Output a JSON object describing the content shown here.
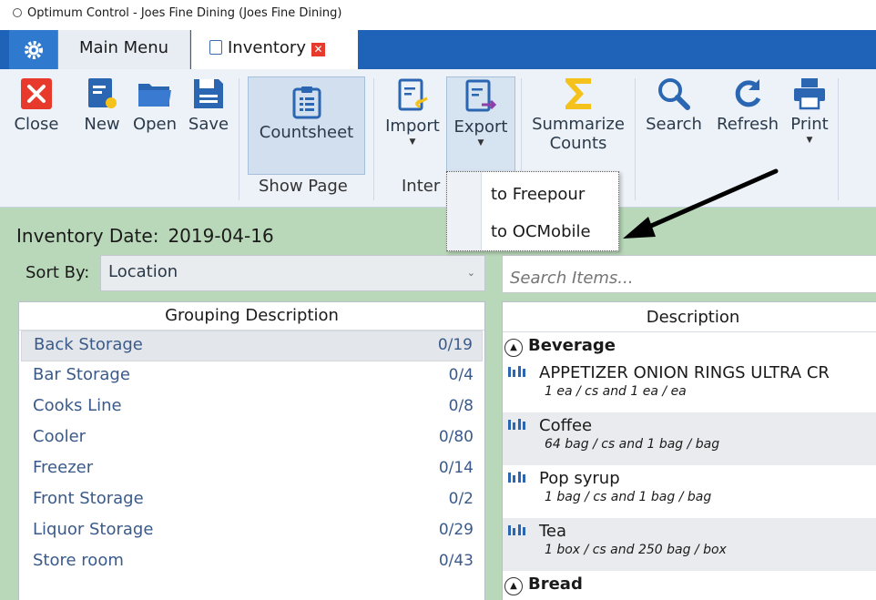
{
  "window": {
    "title": "Optimum Control -  Joes Fine Dining (Joes Fine Dining)"
  },
  "tabs": {
    "main_menu": "Main Menu",
    "inventory": "Inventory"
  },
  "ribbon": {
    "close": "Close",
    "new": "New",
    "open": "Open",
    "save": "Save",
    "countsheet": "Countsheet",
    "import": "Import",
    "export": "Export",
    "summarize_line1": "Summarize",
    "summarize_line2": "Counts",
    "search": "Search",
    "refresh": "Refresh",
    "print": "Print",
    "group_show_page": "Show Page",
    "group_inter": "Inter"
  },
  "export_menu": {
    "items": [
      "to Freepour",
      "to OCMobile"
    ]
  },
  "inventory": {
    "date_label": "Inventory Date:",
    "date_value": "2019-04-16",
    "sort_label": "Sort By:",
    "sort_value": "Location",
    "search_placeholder": "Search Items..."
  },
  "groups": {
    "header": "Grouping Description",
    "rows": [
      {
        "name": "Back Storage",
        "count": "0/19"
      },
      {
        "name": "Bar Storage",
        "count": "0/4"
      },
      {
        "name": "Cooks Line",
        "count": "0/8"
      },
      {
        "name": "Cooler",
        "count": "0/80"
      },
      {
        "name": "Freezer",
        "count": "0/14"
      },
      {
        "name": "Front Storage",
        "count": "0/2"
      },
      {
        "name": "Liquor Storage",
        "count": "0/29"
      },
      {
        "name": "Store room",
        "count": "0/43"
      }
    ]
  },
  "items": {
    "header": "Description",
    "cat1": "Beverage",
    "cat2": "Bread",
    "rows": [
      {
        "name": "APPETIZER ONION RINGS ULTRA CR",
        "unit": "1 ea / cs and 1 ea / ea"
      },
      {
        "name": "Coffee",
        "unit": "64 bag / cs and 1 bag / bag"
      },
      {
        "name": "Pop syrup",
        "unit": "1 bag / cs and 1 bag / bag"
      },
      {
        "name": "Tea",
        "unit": "1 box / cs and 250 bag / box"
      }
    ]
  },
  "colors": {
    "tab_strip": "#1e63b7",
    "ribbon_bg": "#edf2f8",
    "panel_green": "#b9d8b9",
    "close_red": "#e7392c",
    "icon_blue": "#2b66b3",
    "sigma_yellow": "#f4c21a"
  },
  "icons": {
    "settings": "gear-icon",
    "close": "close-icon",
    "new": "new-document-icon",
    "open": "folder-icon",
    "save": "floppy-disk-icon",
    "countsheet": "clipboard-icon",
    "import": "import-icon",
    "export": "export-icon",
    "summarize": "sigma-icon",
    "search": "magnifier-icon",
    "refresh": "refresh-icon",
    "print": "printer-icon"
  }
}
